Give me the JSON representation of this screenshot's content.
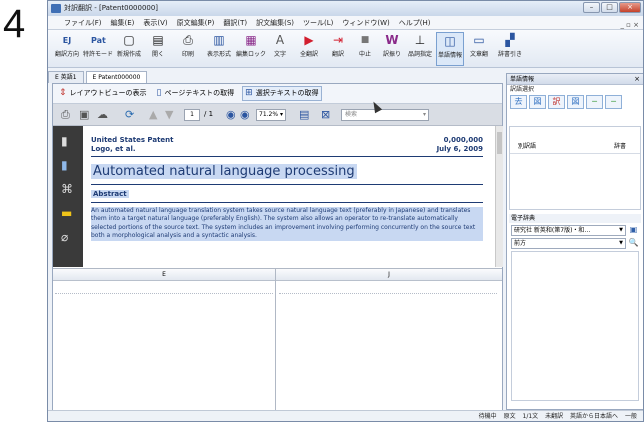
{
  "step_number": "4",
  "window": {
    "title": "対訳翻訳 - [Patent0000000]",
    "buttons": [
      "–",
      "□",
      "×"
    ]
  },
  "menu": {
    "items": [
      "ファイル(F)",
      "編集(E)",
      "表示(V)",
      "原文編集(P)",
      "翻訳(T)",
      "訳文編集(S)",
      "ツール(L)",
      "ウィンドウ(W)",
      "ヘルプ(H)"
    ],
    "mdi_controls": "_ ▫ ×"
  },
  "toolbar": {
    "buttons": [
      {
        "label": "翻訳方向",
        "icon": "EJ"
      },
      {
        "label": "特許モード",
        "icon": "Pat"
      },
      {
        "label": "新規作成",
        "icon": "▢"
      },
      {
        "label": "開く",
        "icon": "▤"
      },
      {
        "label": "印刷",
        "icon": "⎙"
      },
      {
        "label": "表示形式",
        "icon": "▥"
      },
      {
        "label": "編集ロック",
        "icon": "▦"
      },
      {
        "label": "文字",
        "icon": "A"
      },
      {
        "label": "全翻訳",
        "icon": "▶"
      },
      {
        "label": "翻訳",
        "icon": "⇥"
      },
      {
        "label": "中止",
        "icon": "■"
      },
      {
        "label": "訳振り",
        "icon": "W"
      },
      {
        "label": "品詞指定",
        "icon": "⊥"
      },
      {
        "label": "単語情報",
        "icon": "◫"
      },
      {
        "label": "文章翻",
        "icon": "▭"
      },
      {
        "label": "辞書引き",
        "icon": "▞"
      }
    ]
  },
  "tabs": [
    "E  英語1",
    "E  Patent000000"
  ],
  "commands": {
    "layout_view": "レイアウトビューの表示",
    "get_page_text": "ページテキストの取得",
    "get_selected_text": "選択テキストの取得"
  },
  "pdf_toolbar": {
    "page_current": "1",
    "page_total": "/ 1",
    "zoom": "71.2%",
    "search_placeholder": "検索"
  },
  "document": {
    "header_left_line1": "United States Patent",
    "header_left_line2": "Logo, et al.",
    "header_right_line1": "0,000,000",
    "header_right_line2": "July 6, 2009",
    "title": "Automated natural language processing",
    "abstract_heading": "Abstract",
    "abstract_text": "An automated natural language translation system takes source natural language text (preferably in Japanese) and translates them into a target natural language (preferably English). The system also allows an operator to re-translate automatically selected portions of the source text. The system includes an improvement involving performing concurrently on the source text both a morphological analysis and a syntactic analysis."
  },
  "split": {
    "left_header": "E",
    "right_header": "J"
  },
  "right_panel": {
    "title": "単語情報",
    "close": "×",
    "sub_label": "訳語選択",
    "icons": [
      "去",
      "図",
      "訳",
      "図",
      "─",
      "─"
    ],
    "trans_col1": "別訳語",
    "trans_col2": "辞書",
    "dict_label": "電子辞典",
    "dict_select": "研究社 新英和(第7版)・和…",
    "dict_mode": "前方",
    "dict_search_icon": "🔍"
  },
  "status": {
    "items": [
      "待機中",
      "原文",
      "1/1文",
      "未翻訳",
      "英語から日本語へ",
      "一般"
    ]
  }
}
